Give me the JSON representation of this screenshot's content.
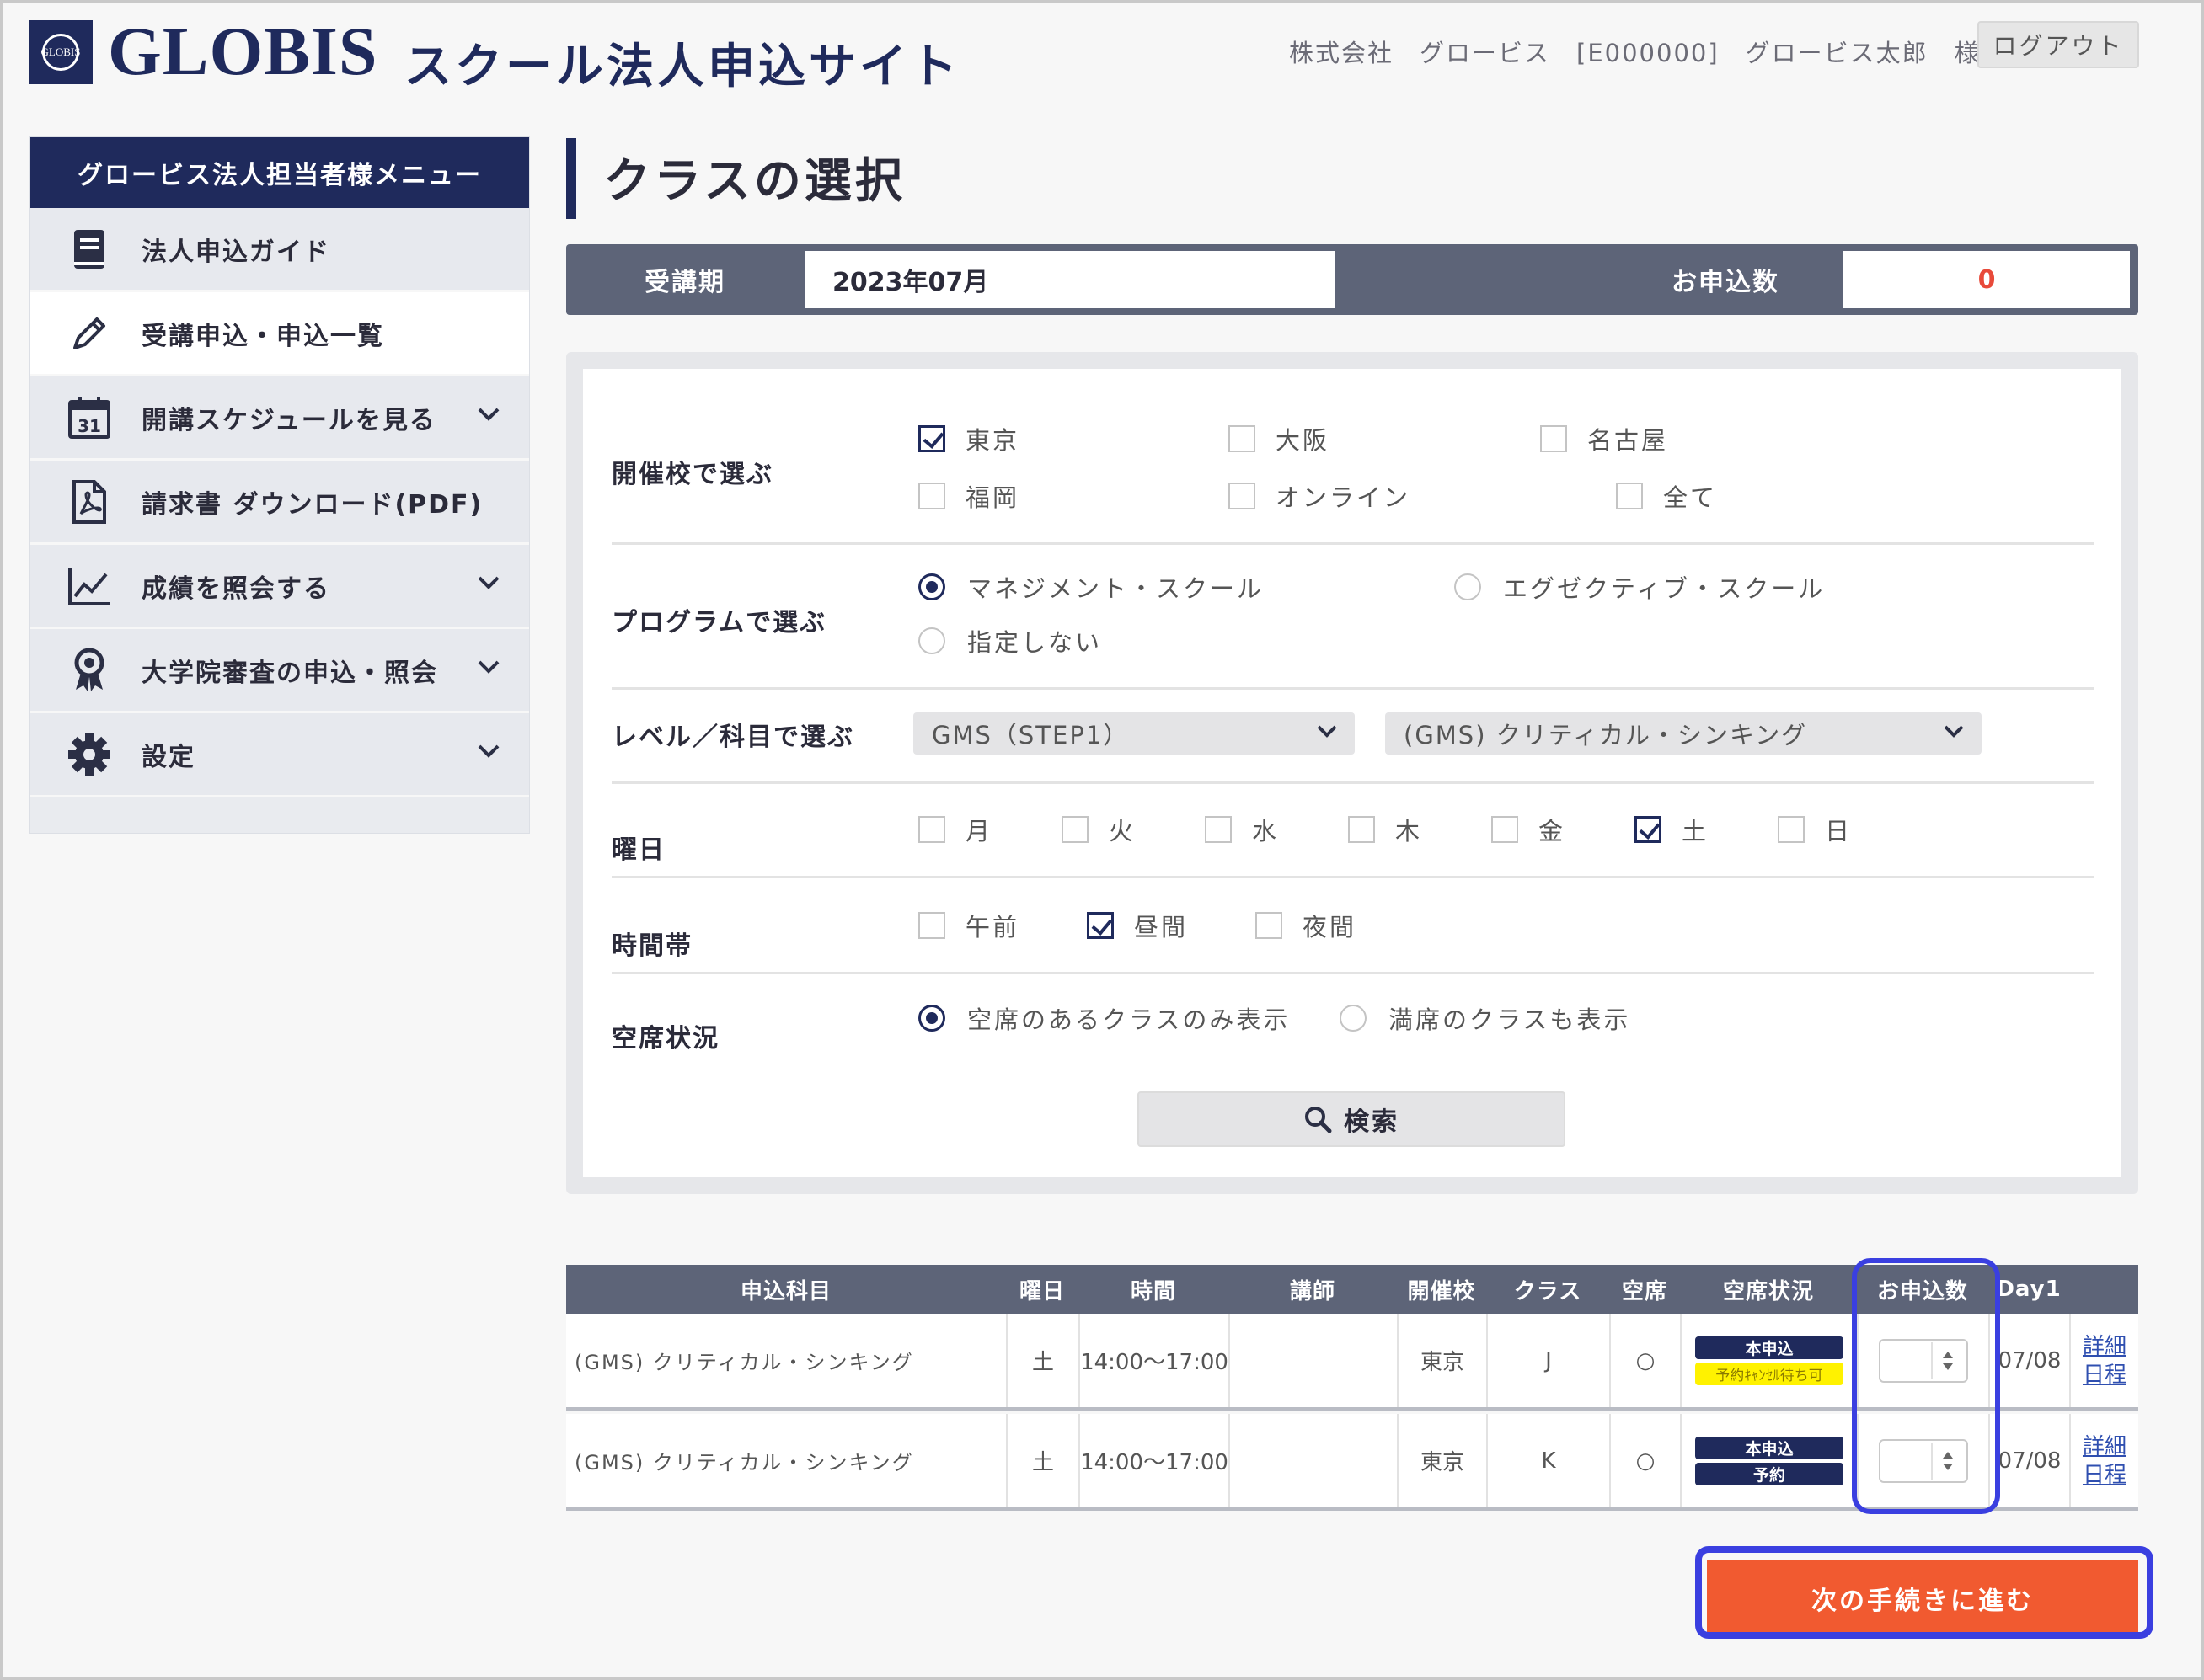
{
  "header": {
    "brand": "GLOBIS",
    "logo_text": "GLOBIS",
    "site_title": "スクール法人申込サイト",
    "user_info": "株式会社　グロービス　[E000000]　グロービス太郎　様",
    "logout_label": "ログアウト"
  },
  "sidebar": {
    "heading": "グロービス法人担当者様メニュー",
    "items": [
      {
        "label": "法人申込ガイド",
        "icon": "book-icon"
      },
      {
        "label": "受講申込・申込一覧",
        "icon": "pencil-icon"
      },
      {
        "label": "開講スケジュールを見る",
        "icon": "calendar-icon",
        "calendar_day": "31"
      },
      {
        "label": "請求書 ダウンロード(PDF)",
        "icon": "pdf-file-icon"
      },
      {
        "label": "成績を照会する",
        "icon": "chart-line-icon"
      },
      {
        "label": "大学院審査の申込・照会",
        "icon": "award-ribbon-icon"
      },
      {
        "label": "設定",
        "icon": "gear-icon"
      }
    ]
  },
  "main": {
    "title": "クラスの選択",
    "period": {
      "label": "受講期",
      "value": "2023年07月"
    },
    "count": {
      "label": "お申込数",
      "value": "0"
    }
  },
  "filters": {
    "school": {
      "label": "開催校で選ぶ",
      "options": [
        {
          "label": "東京",
          "checked": true
        },
        {
          "label": "大阪",
          "checked": false
        },
        {
          "label": "名古屋",
          "checked": false
        },
        {
          "label": "福岡",
          "checked": false
        },
        {
          "label": "オンライン",
          "checked": false
        },
        {
          "label": "全て",
          "checked": false
        }
      ]
    },
    "program": {
      "label": "プログラムで選ぶ",
      "options": [
        {
          "label": "マネジメント・スクール",
          "selected": true
        },
        {
          "label": "エグゼクティブ・スクール",
          "selected": false
        },
        {
          "label": "指定しない",
          "selected": false
        }
      ]
    },
    "level": {
      "label": "レベル／科目で選ぶ",
      "level_value": "GMS（STEP1）",
      "subject_value": "(GMS) クリティカル・シンキング"
    },
    "weekday": {
      "label": "曜日",
      "options": [
        {
          "label": "月",
          "checked": false
        },
        {
          "label": "火",
          "checked": false
        },
        {
          "label": "水",
          "checked": false
        },
        {
          "label": "木",
          "checked": false
        },
        {
          "label": "金",
          "checked": false
        },
        {
          "label": "土",
          "checked": true
        },
        {
          "label": "日",
          "checked": false
        }
      ]
    },
    "timeslot": {
      "label": "時間帯",
      "options": [
        {
          "label": "午前",
          "checked": false
        },
        {
          "label": "昼間",
          "checked": true
        },
        {
          "label": "夜間",
          "checked": false
        }
      ]
    },
    "availability": {
      "label": "空席状況",
      "options": [
        {
          "label": "空席のあるクラスのみ表示",
          "selected": true
        },
        {
          "label": "満席のクラスも表示",
          "selected": false
        }
      ]
    },
    "search_label": "検索"
  },
  "table": {
    "headers": [
      "申込科目",
      "曜日",
      "時間",
      "講師",
      "開催校",
      "クラス",
      "空席",
      "空席状況",
      "お申込数",
      "Day1"
    ],
    "rows": [
      {
        "subject": "(GMS) クリティカル・シンキング",
        "weekday": "土",
        "time": "14:00〜17:00",
        "teacher": "",
        "school": "東京",
        "class": "J",
        "seat": "○",
        "status_main": "本申込",
        "status_sub": "予約ｷｬﾝｾﾙ待ち可",
        "status_sub_color": "#fff200",
        "qty": "",
        "day1": "07/08",
        "detail_label": "詳細",
        "schedule_label": "日程"
      },
      {
        "subject": "(GMS) クリティカル・シンキング",
        "weekday": "土",
        "time": "14:00〜17:00",
        "teacher": "",
        "school": "東京",
        "class": "K",
        "seat": "○",
        "status_main": "本申込",
        "status_sub": "予約",
        "status_sub_color": "#1f2a5c",
        "qty": "",
        "day1": "07/08",
        "detail_label": "詳細",
        "schedule_label": "日程"
      }
    ]
  },
  "next_label": "次の手続きに進む",
  "colors": {
    "navy": "#1f2a5c",
    "slate": "#5d6478",
    "accent": "#f15a30",
    "highlight": "#3a3fe0",
    "count": "#e84a3a"
  }
}
